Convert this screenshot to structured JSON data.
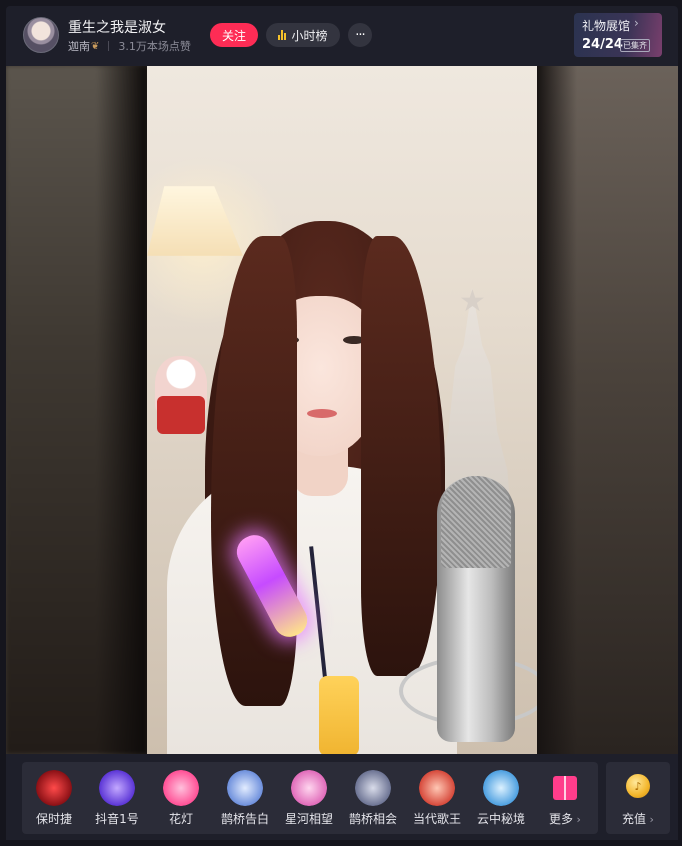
{
  "header": {
    "streamer_name": "重生之我是淑女",
    "badge_name": "迦南",
    "likes": "3.1万本场点赞",
    "follow_label": "关注",
    "rank_label": "小时榜",
    "more_label": "···",
    "gallery": {
      "title": "礼物展馆",
      "count": "24/24",
      "tag": "已集齐"
    }
  },
  "gifts": [
    {
      "label": "保时捷",
      "icon": "sports-car-icon",
      "color": "#d8282e"
    },
    {
      "label": "抖音1号",
      "icon": "rocket-icon",
      "color": "#7a5cff"
    },
    {
      "label": "花灯",
      "icon": "lantern-icon",
      "color": "#ff6fa3"
    },
    {
      "label": "鹊桥告白",
      "icon": "crystal-ball-icon",
      "color": "#8fb6ff"
    },
    {
      "label": "星河相望",
      "icon": "galaxy-icon",
      "color": "#ff9bd2"
    },
    {
      "label": "鹊桥相会",
      "icon": "magpie-icon",
      "color": "#9aa3c4"
    },
    {
      "label": "当代歌王",
      "icon": "singer-icon",
      "color": "#ff7a59"
    },
    {
      "label": "云中秘境",
      "icon": "cloud-castle-icon",
      "color": "#7ec8ff"
    },
    {
      "label": "更多",
      "icon": "gift-box-icon",
      "color": "#ff3d8b"
    }
  ],
  "recharge": {
    "label": "充值",
    "coin_symbol": "♪"
  },
  "colors": {
    "accent": "#fe2c55",
    "panel": "#2b2c38",
    "header_bg": "#1e1f2a",
    "rank_bar": "#f5c22b"
  }
}
